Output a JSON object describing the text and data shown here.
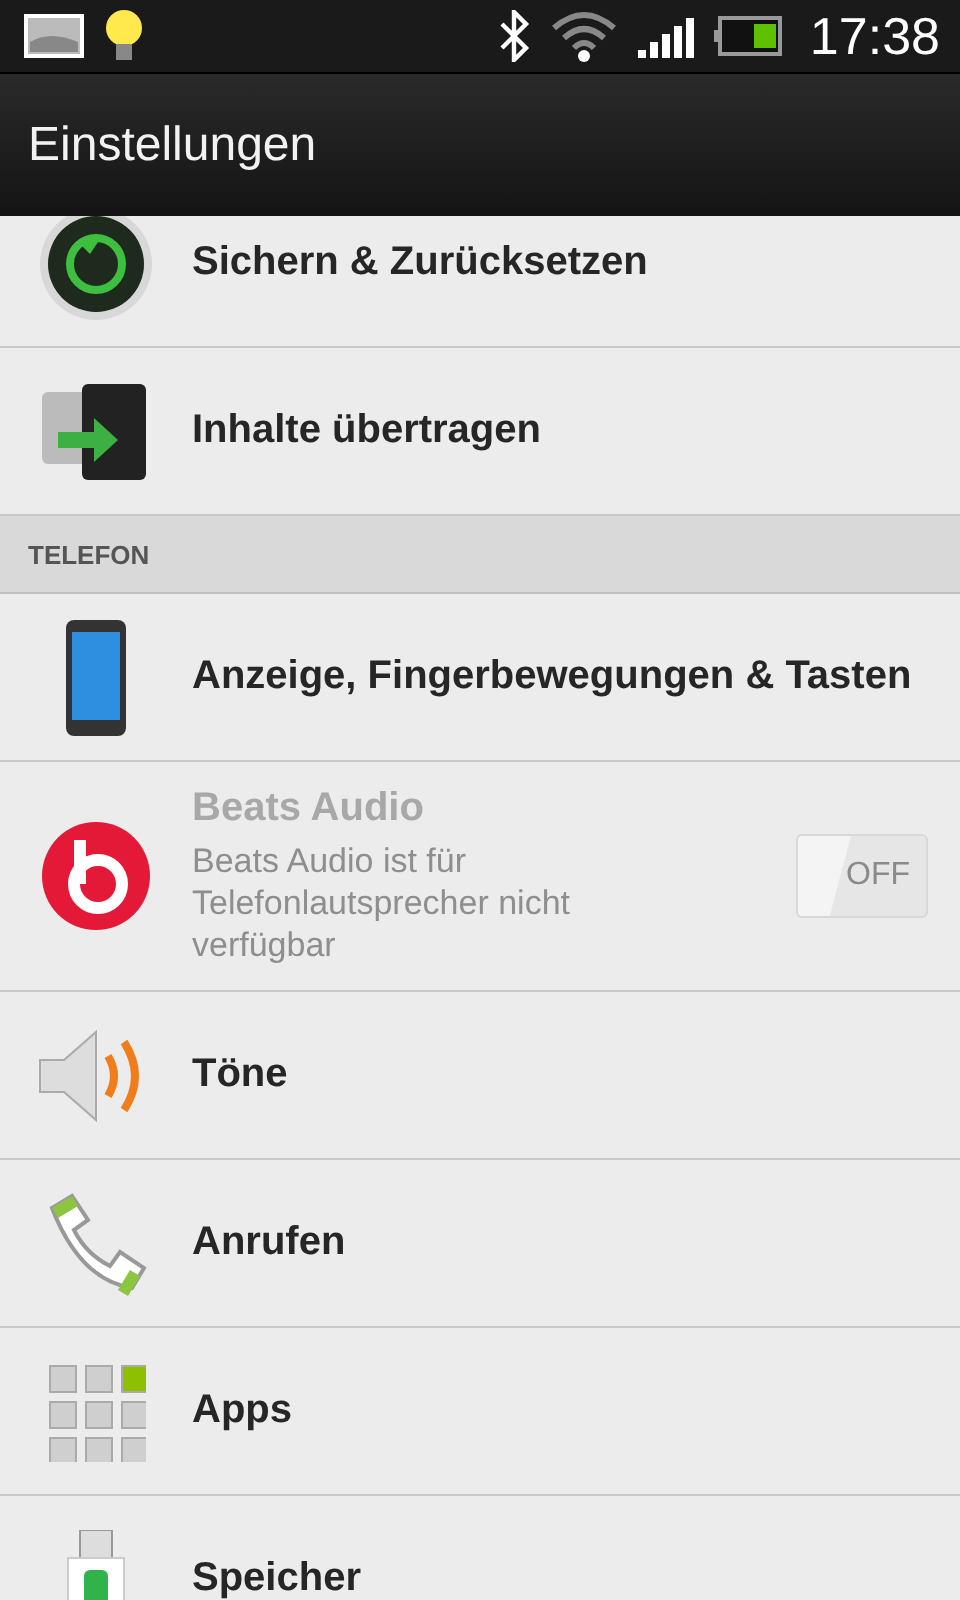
{
  "status_bar": {
    "time": "17:38"
  },
  "title_bar": {
    "title": "Einstellungen"
  },
  "list": [
    {
      "kind": "setting",
      "label": "Sichern & Zurücksetzen"
    },
    {
      "kind": "setting",
      "label": "Inhalte übertragen"
    },
    {
      "kind": "header",
      "label": "TELEFON"
    },
    {
      "kind": "setting",
      "label": "Anzeige, Fingerbewegungen & Tasten"
    },
    {
      "kind": "toggle",
      "label": "Beats Audio",
      "summary": "Beats Audio ist für Telefonlautsprecher nicht verfügbar",
      "disabled": true,
      "on": false,
      "switch_label": "OFF"
    },
    {
      "kind": "setting",
      "label": "Töne"
    },
    {
      "kind": "setting",
      "label": "Anrufen"
    },
    {
      "kind": "setting",
      "label": "Apps"
    },
    {
      "kind": "setting",
      "label": "Speicher"
    }
  ]
}
